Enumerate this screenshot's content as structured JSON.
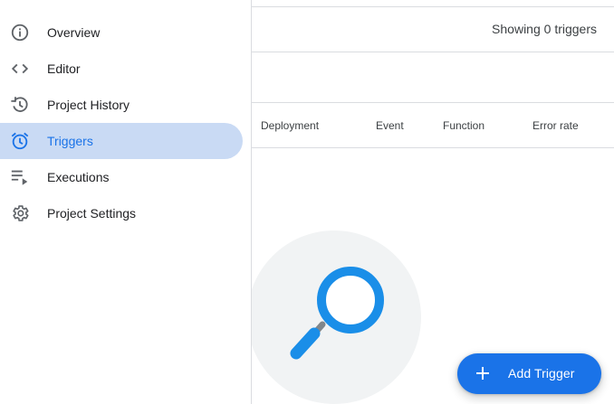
{
  "summary": {
    "text": "Showing 0 triggers"
  },
  "table": {
    "columns": [
      "Deployment",
      "Event",
      "Function",
      "Error rate"
    ]
  },
  "fab": {
    "label": "Add Trigger",
    "icon": "plus-icon"
  },
  "nav": {
    "items": [
      {
        "label": "Overview",
        "icon": "info-icon",
        "active": false
      },
      {
        "label": "Editor",
        "icon": "code-icon",
        "active": false
      },
      {
        "label": "Project History",
        "icon": "history-icon",
        "active": false
      },
      {
        "label": "Triggers",
        "icon": "alarm-icon",
        "active": true
      },
      {
        "label": "Executions",
        "icon": "playlist-play-icon",
        "active": false
      },
      {
        "label": "Project Settings",
        "icon": "gear-icon",
        "active": false
      }
    ]
  },
  "colors": {
    "accent": "#1a73e8",
    "active_nav_bg": "#c9daf4",
    "icon_grey": "#5f6368",
    "illustration_bg": "#f1f3f4",
    "magnifier_blue": "#1a8ee8"
  }
}
